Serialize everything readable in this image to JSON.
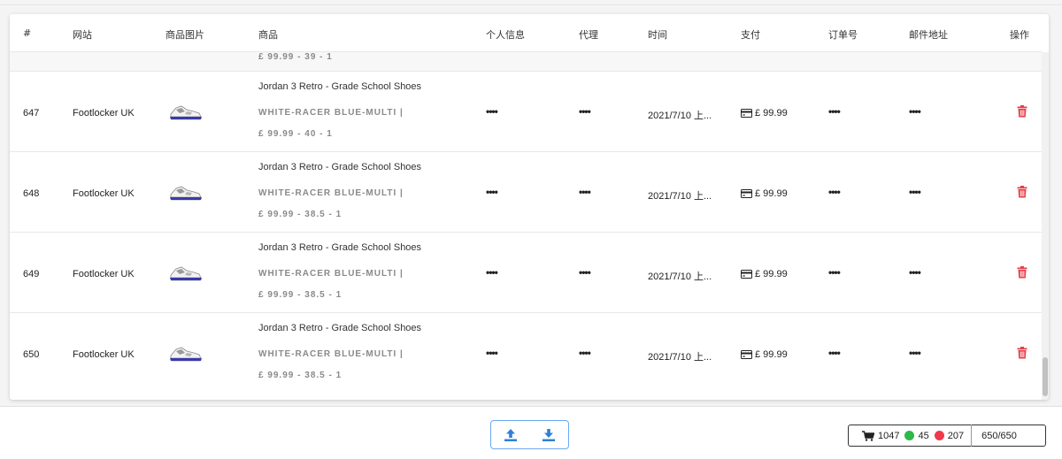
{
  "table": {
    "headers": {
      "id": "#",
      "site": "网站",
      "image": "商品图片",
      "product": "商品",
      "personal": "个人信息",
      "proxy": "代理",
      "time": "时间",
      "payment": "支付",
      "order": "订单号",
      "email": "邮件地址",
      "actions": "操作"
    },
    "partial_row_price": "£ 99.99 - 39 - 1",
    "rows": [
      {
        "id": "647",
        "site": "Footlocker UK",
        "product_title": "Jordan 3 Retro - Grade School Shoes",
        "variant": "WHITE-RACER BLUE-MULTI |",
        "price_line": "£ 99.99 - 40 - 1",
        "personal": "••••",
        "proxy": "••••",
        "time": "2021/7/10 上...",
        "payment": "£ 99.99",
        "order": "••••",
        "email": "••••"
      },
      {
        "id": "648",
        "site": "Footlocker UK",
        "product_title": "Jordan 3 Retro - Grade School Shoes",
        "variant": "WHITE-RACER BLUE-MULTI |",
        "price_line": "£ 99.99 - 38.5 - 1",
        "personal": "••••",
        "proxy": "••••",
        "time": "2021/7/10 上...",
        "payment": "£ 99.99",
        "order": "••••",
        "email": "••••"
      },
      {
        "id": "649",
        "site": "Footlocker UK",
        "product_title": "Jordan 3 Retro - Grade School Shoes",
        "variant": "WHITE-RACER BLUE-MULTI |",
        "price_line": "£ 99.99 - 38.5 - 1",
        "personal": "••••",
        "proxy": "••••",
        "time": "2021/7/10 上...",
        "payment": "£ 99.99",
        "order": "••••",
        "email": "••••"
      },
      {
        "id": "650",
        "site": "Footlocker UK",
        "product_title": "Jordan 3 Retro - Grade School Shoes",
        "variant": "WHITE-RACER BLUE-MULTI |",
        "price_line": "£ 99.99 - 38.5 - 1",
        "personal": "••••",
        "proxy": "••••",
        "time": "2021/7/10 上...",
        "payment": "£ 99.99",
        "order": "••••",
        "email": "••••"
      }
    ],
    "icons": {
      "product_image": "sneaker-thumbnail",
      "payment": "credit-card-icon",
      "delete": "trash-icon"
    }
  },
  "footer": {
    "icons": {
      "upload": "upload-icon",
      "download": "download-icon"
    },
    "status": {
      "cart_icon": "cart-icon",
      "cart_count": "1047",
      "success_count": "45",
      "fail_count": "207",
      "progress": "650/650"
    }
  },
  "colors": {
    "accent": "#2f7fd8",
    "delete": "#e8404a",
    "success": "#2db84a",
    "fail": "#f03a4a"
  }
}
